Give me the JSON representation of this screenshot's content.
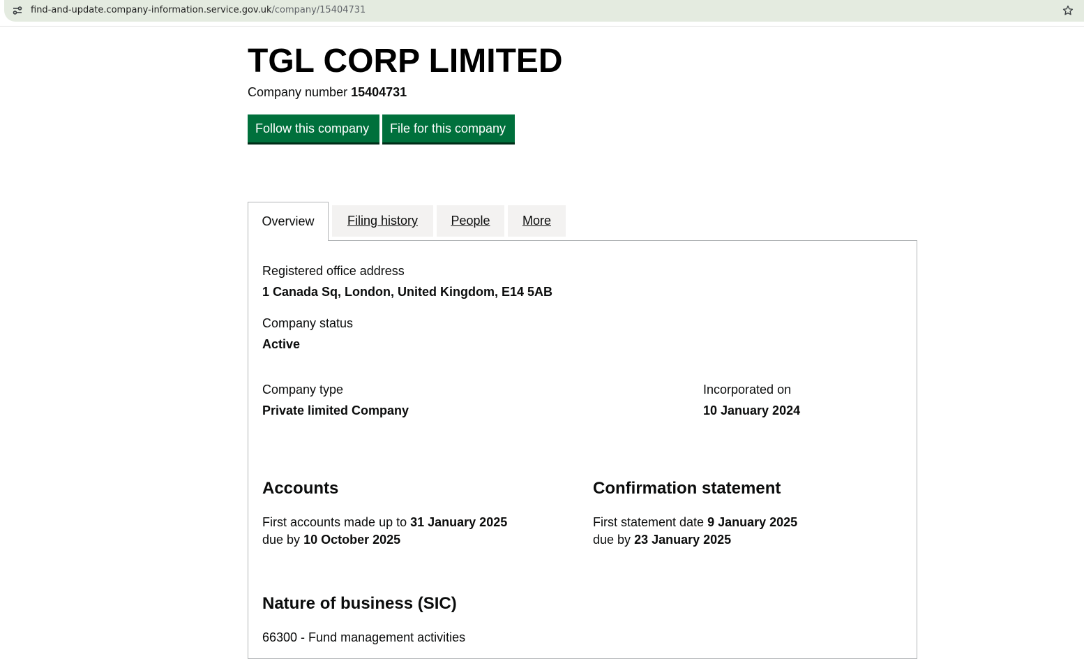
{
  "browser": {
    "url_host": "find-and-update.company-information.service.gov.uk",
    "url_path": "/company/15404731"
  },
  "company": {
    "name": "TGL CORP LIMITED",
    "number_label": "Company number",
    "number": "15404731"
  },
  "actions": {
    "follow_label": "Follow this company",
    "file_label": "File for this company"
  },
  "tabs": [
    {
      "label": "Overview",
      "active": true
    },
    {
      "label": "Filing history",
      "active": false
    },
    {
      "label": "People",
      "active": false
    },
    {
      "label": "More",
      "active": false
    }
  ],
  "overview": {
    "registered_office": {
      "label": "Registered office address",
      "value": "1 Canada Sq, London, United Kingdom, E14 5AB"
    },
    "status": {
      "label": "Company status",
      "value": "Active"
    },
    "type": {
      "label": "Company type",
      "value": "Private limited Company"
    },
    "incorporated": {
      "label": "Incorporated on",
      "value": "10 January 2024"
    },
    "accounts": {
      "heading": "Accounts",
      "first_prefix": "First accounts made up to",
      "first_date": "31 January 2025",
      "due_prefix": "due by",
      "due_date": "10 October 2025"
    },
    "confirmation": {
      "heading": "Confirmation statement",
      "first_prefix": "First statement date",
      "first_date": "9 January 2025",
      "due_prefix": "due by",
      "due_date": "23 January 2025"
    },
    "sic": {
      "heading": "Nature of business (SIC)",
      "items": [
        "66300 - Fund management activities"
      ]
    }
  },
  "colors": {
    "button_green": "#00703c",
    "button_shadow": "#002d18",
    "omnibox_bg": "#e4ebe0",
    "tab_inactive_bg": "#f3f2f1",
    "border": "#b1b4b6"
  }
}
